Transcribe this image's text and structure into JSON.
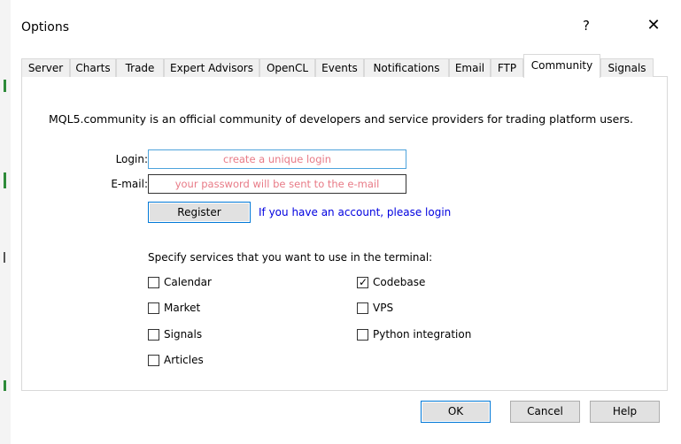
{
  "window": {
    "title": "Options",
    "help_symbol": "?",
    "close_symbol": "✕"
  },
  "tabs": [
    {
      "label": "Server",
      "active": false
    },
    {
      "label": "Charts",
      "active": false
    },
    {
      "label": "Trade",
      "active": false
    },
    {
      "label": "Expert Advisors",
      "active": false
    },
    {
      "label": "OpenCL",
      "active": false
    },
    {
      "label": "Events",
      "active": false
    },
    {
      "label": "Notifications",
      "active": false
    },
    {
      "label": "Email",
      "active": false
    },
    {
      "label": "FTP",
      "active": false
    },
    {
      "label": "Community",
      "active": true
    },
    {
      "label": "Signals",
      "active": false
    }
  ],
  "community": {
    "intro": "MQL5.community is an official community of developers and service providers for trading platform users.",
    "login_label": "Login:",
    "login_placeholder": "create a unique login",
    "email_label": "E-mail:",
    "email_placeholder": "your password will be sent to the e-mail",
    "register_label": "Register",
    "login_link": "If you have an account, please login",
    "services_title": "Specify services that you want to use in the terminal:",
    "services": [
      {
        "label": "Calendar",
        "checked": false
      },
      {
        "label": "Market",
        "checked": false
      },
      {
        "label": "Signals",
        "checked": false
      },
      {
        "label": "Articles",
        "checked": false
      },
      {
        "label": "Codebase",
        "checked": true
      },
      {
        "label": "VPS",
        "checked": false
      },
      {
        "label": "Python integration",
        "checked": false
      }
    ]
  },
  "footer": {
    "ok_label": "OK",
    "cancel_label": "Cancel",
    "help_label": "Help"
  },
  "colors": {
    "accent_blue": "#0078d7",
    "link_blue": "#0000e0",
    "placeholder_pink": "#e87a86"
  }
}
